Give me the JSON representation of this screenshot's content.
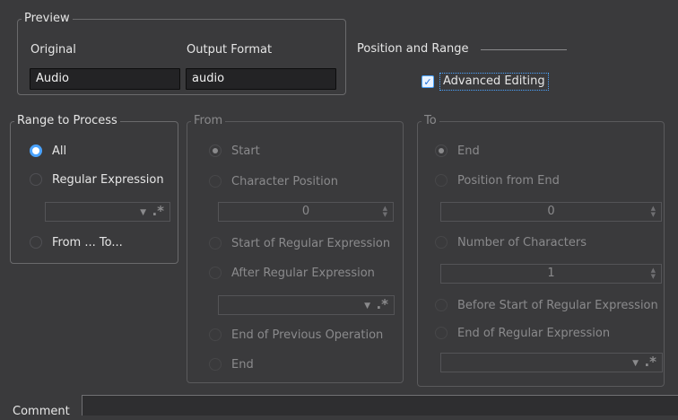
{
  "preview": {
    "title": "Preview",
    "original_label": "Original",
    "original_value": "Audio",
    "output_label": "Output Format",
    "output_value": "audio"
  },
  "position": {
    "title": "Position and Range",
    "advanced_editing_label": "Advanced Editing",
    "advanced_editing_checked": true
  },
  "range": {
    "title": "Range to Process",
    "all_label": "All",
    "regex_label": "Regular Expression",
    "from_to_label": "From ... To..."
  },
  "from": {
    "title": "From",
    "start_label": "Start",
    "char_pos_label": "Character Position",
    "char_pos_value": "0",
    "start_regex_label": "Start of Regular Expression",
    "after_regex_label": "After Regular Expression",
    "end_prev_label": "End of Previous Operation",
    "end_label": "End"
  },
  "to": {
    "title": "To",
    "end_label": "End",
    "pos_from_end_label": "Position from End",
    "pos_from_end_value": "0",
    "num_chars_label": "Number of Characters",
    "num_chars_value": "1",
    "before_start_regex_label": "Before Start of Regular Expression",
    "end_regex_label": "End of Regular Expression"
  },
  "comment": {
    "label": "Comment"
  },
  "colors": {
    "accent": "#4aa3ff",
    "background": "#3a3a3c"
  }
}
